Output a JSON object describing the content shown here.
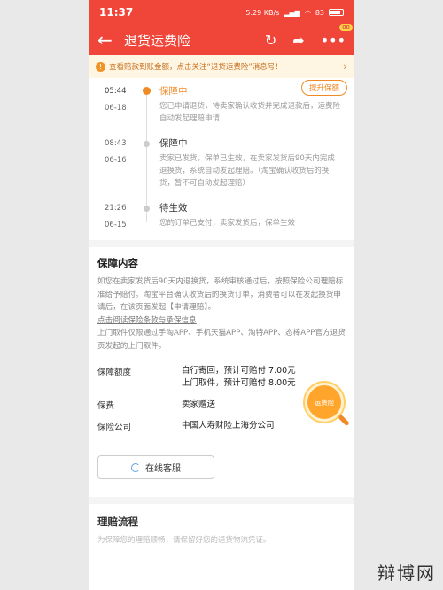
{
  "status_bar": {
    "time": "11:37",
    "net": "5.29 KB/s",
    "battery": "83"
  },
  "header": {
    "title": "退货运费险",
    "badge": "88"
  },
  "notice": {
    "text": "查看赔款到账金额，点击关注“退货运费险”消息号！"
  },
  "timeline": {
    "upgrade_button": "提升保额",
    "items": [
      {
        "time": "05:44",
        "date": "06-18",
        "status": "保障中",
        "desc": "您已申请退货，待卖家确认收货并完成退款后，运费险自动发起理赔申请"
      },
      {
        "time": "08:43",
        "date": "06-16",
        "status": "保障中",
        "desc": "卖家已发货，保单已生效，在卖家发货后90天内完成退换货，系统自动发起理赔。（淘宝确认收货后的换货，暂不可自动发起理赔）"
      },
      {
        "time": "21:26",
        "date": "06-15",
        "status": "待生效",
        "desc": "您的订单已支付，卖家发货后，保单生效"
      }
    ]
  },
  "coverage": {
    "title": "保障内容",
    "para1": "如您在卖家发货后90天内退换货，系统审核通过后，按照保险公司理赔标准给予赔付。淘宝平台确认收货后的换货订单，消费者可以在发起换货申请后，在该页面发起【申请理赔】。",
    "link": "点击阅读保险条款与承保信息",
    "para2": "上门取件仅限通过手淘APP、手机天猫APP、淘特APP、态棒APP官方退货页发起的上门取件。",
    "amount_label": "保障额度",
    "amount_line1": "自行寄回，预计可赔付 7.00元",
    "amount_line2": "上门取件，预计可赔付 8.00元",
    "fee_label": "保费",
    "fee_value": "卖家赠送",
    "insurer_label": "保险公司",
    "insurer_value": "中国人寿财险上海分公司",
    "magnifier": "运费险"
  },
  "service_button": "在线客服",
  "claim": {
    "title": "理赔流程",
    "desc": "为保障您的理赔顺畅，请保留好您的退货物流凭证。"
  },
  "watermark": "辩博网"
}
